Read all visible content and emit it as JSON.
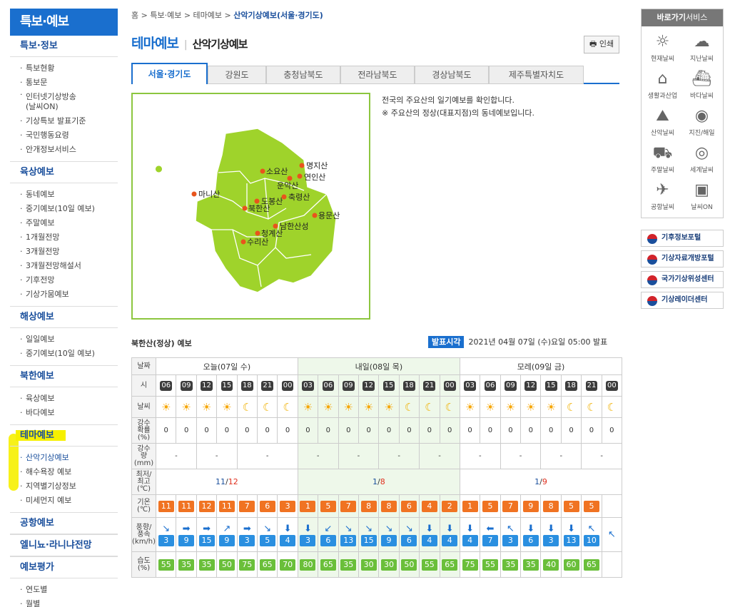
{
  "lnb": {
    "title": "특보·예보",
    "sections": [
      {
        "head": "특보·정보",
        "items": [
          "특보현황",
          "통보문",
          "인터넷기상방송\n(날씨ON)",
          "기상특보 발표기준",
          "국민행동요령",
          "안개정보서비스"
        ]
      },
      {
        "head": "육상예보",
        "items": [
          "동네예보",
          "중기예보(10일 예보)",
          "주말예보",
          "1개월전망",
          "3개월전망",
          "3개월전망해설서",
          "기후전망",
          "기상가뭄예보"
        ]
      },
      {
        "head": "해상예보",
        "items": [
          "일일예보",
          "중기예보(10일 예보)"
        ]
      },
      {
        "head": "북한예보",
        "items": [
          "육상예보",
          "바다예보"
        ]
      },
      {
        "head": "테마예보",
        "items": [
          "산악기상예보",
          "해수욕장 예보",
          "지역별기상정보",
          "미세먼지 예보"
        ]
      },
      {
        "head": "공항예보",
        "items": []
      },
      {
        "head": "엘니뇨·라니냐전망",
        "items": []
      },
      {
        "head": "예보평가",
        "items": [
          "연도별",
          "월별"
        ]
      }
    ]
  },
  "breadcrumb": {
    "items": [
      "홈",
      "특보·예보",
      "테마예보"
    ],
    "current": "산악기상예보(서울·경기도)"
  },
  "page": {
    "title": "테마예보",
    "subtitle": "산악기상예보",
    "print": "인쇄"
  },
  "tabs": [
    "서울·경기도",
    "강원도",
    "충청남북도",
    "전라남북도",
    "경상남북도",
    "제주특별자치도"
  ],
  "desc": {
    "line1": "전국의 주요산의 일기예보를 확인합니다.",
    "line2": "※ 주요산의 정상(대표지점)의 동네예보입니다."
  },
  "map": {
    "mountains": [
      "명지산",
      "소요산",
      "연인산",
      "운악산",
      "마니산",
      "도봉산",
      "축령산",
      "북한산",
      "용문산",
      "남한산성",
      "청계산",
      "수리산"
    ]
  },
  "forecast": {
    "heading": "북한산(정상) 예보",
    "issue_label": "발표시각",
    "issue_time": "2021년 04월 07일 (수)요일 05:00 발표",
    "row_labels": {
      "date": "날짜",
      "hour": "시",
      "weather": "날씨",
      "pop": "강수\n확률\n(%)",
      "precip": "강수\n량\n(mm)",
      "minmax": "최저/\n최고\n(℃)",
      "temp": "기온\n(℃)",
      "wind": "풍향/\n풍속\n(km/h)",
      "humidity": "습도\n(%)"
    },
    "days": [
      {
        "label": "오늘(07일 수)",
        "count": 7,
        "min": "11",
        "max": "12"
      },
      {
        "label": "내일(08일 목)",
        "count": 8,
        "min": "1",
        "max": "8"
      },
      {
        "label": "모레(09일 금)",
        "count": 8,
        "min": "1",
        "max": "9"
      }
    ],
    "minmax_sep": "/",
    "hours": [
      "06",
      "09",
      "12",
      "15",
      "18",
      "21",
      "00",
      "03",
      "06",
      "09",
      "12",
      "15",
      "18",
      "21",
      "00",
      "03",
      "06",
      "09",
      "12",
      "15",
      "18",
      "21",
      "00"
    ],
    "weather": [
      "sun",
      "sun",
      "sun",
      "sun",
      "moon",
      "moon",
      "moon",
      "sun",
      "sun",
      "sun",
      "sun",
      "sun",
      "moon",
      "moon",
      "moon",
      "sun",
      "sun",
      "sun",
      "sun",
      "sun",
      "moon",
      "moon",
      "moon"
    ],
    "pop": [
      "0",
      "0",
      "0",
      "0",
      "0",
      "0",
      "0",
      "0",
      "0",
      "0",
      "0",
      "0",
      "0",
      "0",
      "0",
      "0",
      "0",
      "0",
      "0",
      "0",
      "0",
      "0",
      "0"
    ],
    "precip": [
      "-",
      "-",
      "-",
      "-",
      "-",
      "-",
      "-",
      "-"
    ],
    "temp": [
      "11",
      "11",
      "12",
      "11",
      "7",
      "6",
      "3",
      "1",
      "5",
      "7",
      "8",
      "8",
      "6",
      "4",
      "2",
      "1",
      "5",
      "7",
      "9",
      "8",
      "5",
      "5"
    ],
    "wind_dir": [
      "↘",
      "➡",
      "➡",
      "↗",
      "➡",
      "↘",
      "⬇",
      "⬇",
      "↙",
      "↘",
      "↘",
      "↘",
      "↘",
      "⬇",
      "⬇",
      "⬇",
      "⬅",
      "↖",
      "⬇",
      "⬇",
      "⬇",
      "↖",
      "↖"
    ],
    "wind_speed": [
      "3",
      "9",
      "15",
      "9",
      "3",
      "5",
      "4",
      "3",
      "6",
      "13",
      "15",
      "9",
      "6",
      "4",
      "4",
      "4",
      "7",
      "3",
      "6",
      "3",
      "13",
      "10"
    ],
    "humidity": [
      "55",
      "35",
      "35",
      "50",
      "75",
      "65",
      "70",
      "80",
      "65",
      "35",
      "30",
      "30",
      "50",
      "55",
      "65",
      "75",
      "55",
      "35",
      "35",
      "40",
      "60",
      "65"
    ]
  },
  "quick": {
    "head_bold": "바로가기",
    "head_rest": "서비스",
    "items": [
      {
        "icon": "☼",
        "label": "현재날씨"
      },
      {
        "icon": "☁",
        "label": "지난날씨"
      },
      {
        "icon": "⌂",
        "label": "생활과산업"
      },
      {
        "icon": "⛴",
        "label": "바다날씨"
      },
      {
        "icon": "⛰",
        "label": "산악날씨"
      },
      {
        "icon": "◉",
        "label": "지진/해일"
      },
      {
        "icon": "⛟",
        "label": "주말날씨"
      },
      {
        "icon": "◎",
        "label": "세계날씨"
      },
      {
        "icon": "✈",
        "label": "공항날씨"
      },
      {
        "icon": "▣",
        "label": "날씨ON"
      }
    ]
  },
  "portals": [
    "기후정보포털",
    "기상자료개방포털",
    "국가기상위성센터",
    "기상레이더센터"
  ]
}
